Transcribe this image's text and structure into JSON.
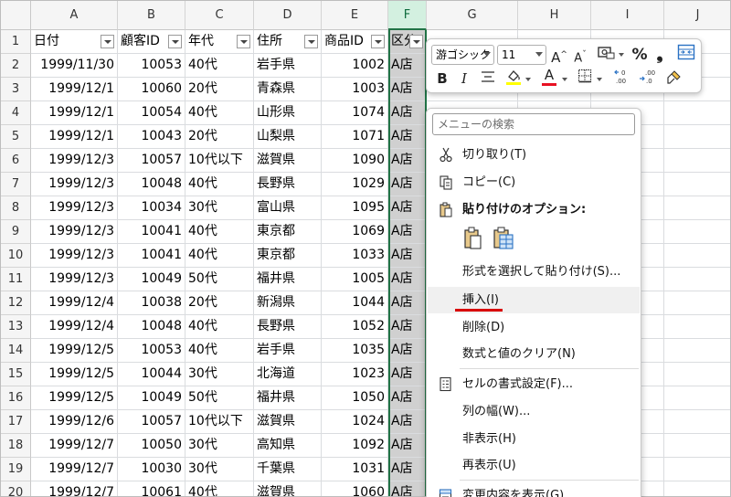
{
  "columns": [
    "A",
    "B",
    "C",
    "D",
    "E",
    "F",
    "G",
    "H",
    "I",
    "J"
  ],
  "headers": [
    "日付",
    "顧客ID",
    "年代",
    "住所",
    "商品ID",
    "区分"
  ],
  "rows": [
    [
      "1999/11/30",
      "10053",
      "40代",
      "岩手県",
      "1002",
      "A店"
    ],
    [
      "1999/12/1",
      "10060",
      "20代",
      "青森県",
      "1003",
      "A店"
    ],
    [
      "1999/12/1",
      "10054",
      "40代",
      "山形県",
      "1074",
      "A店"
    ],
    [
      "1999/12/1",
      "10043",
      "20代",
      "山梨県",
      "1071",
      "A店"
    ],
    [
      "1999/12/3",
      "10057",
      "10代以下",
      "滋賀県",
      "1090",
      "A店"
    ],
    [
      "1999/12/3",
      "10048",
      "40代",
      "長野県",
      "1029",
      "A店"
    ],
    [
      "1999/12/3",
      "10034",
      "30代",
      "富山県",
      "1095",
      "A店"
    ],
    [
      "1999/12/3",
      "10041",
      "40代",
      "東京都",
      "1069",
      "A店"
    ],
    [
      "1999/12/3",
      "10041",
      "40代",
      "東京都",
      "1033",
      "A店"
    ],
    [
      "1999/12/3",
      "10049",
      "50代",
      "福井県",
      "1005",
      "A店"
    ],
    [
      "1999/12/4",
      "10038",
      "20代",
      "新潟県",
      "1044",
      "A店"
    ],
    [
      "1999/12/4",
      "10048",
      "40代",
      "長野県",
      "1052",
      "A店"
    ],
    [
      "1999/12/5",
      "10053",
      "40代",
      "岩手県",
      "1035",
      "A店"
    ],
    [
      "1999/12/5",
      "10044",
      "30代",
      "北海道",
      "1023",
      "A店"
    ],
    [
      "1999/12/5",
      "10049",
      "50代",
      "福井県",
      "1050",
      "A店"
    ],
    [
      "1999/12/6",
      "10057",
      "10代以下",
      "滋賀県",
      "1024",
      "A店"
    ],
    [
      "1999/12/7",
      "10050",
      "30代",
      "高知県",
      "1092",
      "A店"
    ],
    [
      "1999/12/7",
      "10030",
      "30代",
      "千葉県",
      "1031",
      "A店"
    ],
    [
      "1999/12/7",
      "10061",
      "40代",
      "滋賀県",
      "1060",
      "A店"
    ]
  ],
  "row_numbers": [
    "1",
    "2",
    "3",
    "4",
    "5",
    "6",
    "7",
    "8",
    "9",
    "10",
    "11",
    "12",
    "13",
    "14",
    "15",
    "16",
    "17",
    "18",
    "19",
    "20"
  ],
  "selected_column": "F",
  "mini_toolbar": {
    "font_name": "游ゴシック",
    "font_size": "11",
    "grow_font": "A",
    "shrink_font": "A",
    "percent": "%",
    "comma": "❟",
    "bold": "B",
    "italic": "I",
    "font_color_letter": "A",
    "accent_red": "#e81123",
    "accent_yellow": "#ffff00"
  },
  "context_menu": {
    "search_placeholder": "メニューの検索",
    "items": [
      {
        "label": "切り取り(T)",
        "icon": "scissors-icon"
      },
      {
        "label": "コピー(C)",
        "icon": "copy-icon"
      },
      {
        "label": "貼り付けのオプション:",
        "icon": "paste-icon"
      },
      {
        "label": "形式を選択して貼り付け(S)..."
      },
      {
        "label": "挿入(I)"
      },
      {
        "label": "削除(D)"
      },
      {
        "label": "数式と値のクリア(N)"
      },
      {
        "label": "セルの書式設定(F)...",
        "icon": "format-cells-icon"
      },
      {
        "label": "列の幅(W)..."
      },
      {
        "label": "非表示(H)"
      },
      {
        "label": "再表示(U)"
      },
      {
        "label": "変更内容を表示(G)",
        "icon": "show-changes-icon"
      }
    ]
  }
}
